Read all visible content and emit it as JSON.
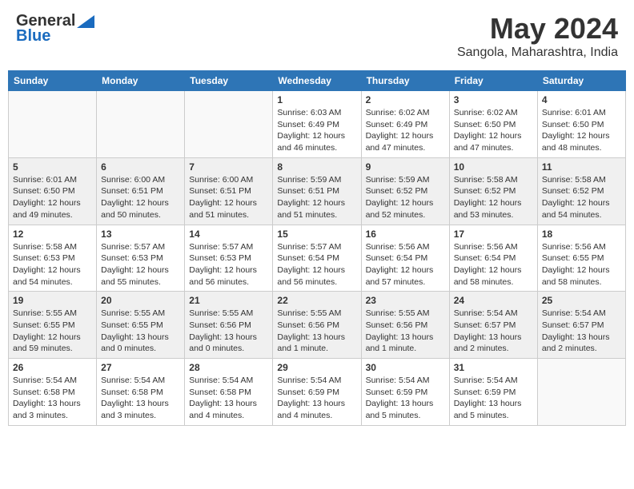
{
  "header": {
    "logo_general": "General",
    "logo_blue": "Blue",
    "month_title": "May 2024",
    "location": "Sangola, Maharashtra, India"
  },
  "weekdays": [
    "Sunday",
    "Monday",
    "Tuesday",
    "Wednesday",
    "Thursday",
    "Friday",
    "Saturday"
  ],
  "weeks": [
    [
      {
        "day": "",
        "text": ""
      },
      {
        "day": "",
        "text": ""
      },
      {
        "day": "",
        "text": ""
      },
      {
        "day": "1",
        "text": "Sunrise: 6:03 AM\nSunset: 6:49 PM\nDaylight: 12 hours\nand 46 minutes."
      },
      {
        "day": "2",
        "text": "Sunrise: 6:02 AM\nSunset: 6:49 PM\nDaylight: 12 hours\nand 47 minutes."
      },
      {
        "day": "3",
        "text": "Sunrise: 6:02 AM\nSunset: 6:50 PM\nDaylight: 12 hours\nand 47 minutes."
      },
      {
        "day": "4",
        "text": "Sunrise: 6:01 AM\nSunset: 6:50 PM\nDaylight: 12 hours\nand 48 minutes."
      }
    ],
    [
      {
        "day": "5",
        "text": "Sunrise: 6:01 AM\nSunset: 6:50 PM\nDaylight: 12 hours\nand 49 minutes."
      },
      {
        "day": "6",
        "text": "Sunrise: 6:00 AM\nSunset: 6:51 PM\nDaylight: 12 hours\nand 50 minutes."
      },
      {
        "day": "7",
        "text": "Sunrise: 6:00 AM\nSunset: 6:51 PM\nDaylight: 12 hours\nand 51 minutes."
      },
      {
        "day": "8",
        "text": "Sunrise: 5:59 AM\nSunset: 6:51 PM\nDaylight: 12 hours\nand 51 minutes."
      },
      {
        "day": "9",
        "text": "Sunrise: 5:59 AM\nSunset: 6:52 PM\nDaylight: 12 hours\nand 52 minutes."
      },
      {
        "day": "10",
        "text": "Sunrise: 5:58 AM\nSunset: 6:52 PM\nDaylight: 12 hours\nand 53 minutes."
      },
      {
        "day": "11",
        "text": "Sunrise: 5:58 AM\nSunset: 6:52 PM\nDaylight: 12 hours\nand 54 minutes."
      }
    ],
    [
      {
        "day": "12",
        "text": "Sunrise: 5:58 AM\nSunset: 6:53 PM\nDaylight: 12 hours\nand 54 minutes."
      },
      {
        "day": "13",
        "text": "Sunrise: 5:57 AM\nSunset: 6:53 PM\nDaylight: 12 hours\nand 55 minutes."
      },
      {
        "day": "14",
        "text": "Sunrise: 5:57 AM\nSunset: 6:53 PM\nDaylight: 12 hours\nand 56 minutes."
      },
      {
        "day": "15",
        "text": "Sunrise: 5:57 AM\nSunset: 6:54 PM\nDaylight: 12 hours\nand 56 minutes."
      },
      {
        "day": "16",
        "text": "Sunrise: 5:56 AM\nSunset: 6:54 PM\nDaylight: 12 hours\nand 57 minutes."
      },
      {
        "day": "17",
        "text": "Sunrise: 5:56 AM\nSunset: 6:54 PM\nDaylight: 12 hours\nand 58 minutes."
      },
      {
        "day": "18",
        "text": "Sunrise: 5:56 AM\nSunset: 6:55 PM\nDaylight: 12 hours\nand 58 minutes."
      }
    ],
    [
      {
        "day": "19",
        "text": "Sunrise: 5:55 AM\nSunset: 6:55 PM\nDaylight: 12 hours\nand 59 minutes."
      },
      {
        "day": "20",
        "text": "Sunrise: 5:55 AM\nSunset: 6:55 PM\nDaylight: 13 hours\nand 0 minutes."
      },
      {
        "day": "21",
        "text": "Sunrise: 5:55 AM\nSunset: 6:56 PM\nDaylight: 13 hours\nand 0 minutes."
      },
      {
        "day": "22",
        "text": "Sunrise: 5:55 AM\nSunset: 6:56 PM\nDaylight: 13 hours\nand 1 minute."
      },
      {
        "day": "23",
        "text": "Sunrise: 5:55 AM\nSunset: 6:56 PM\nDaylight: 13 hours\nand 1 minute."
      },
      {
        "day": "24",
        "text": "Sunrise: 5:54 AM\nSunset: 6:57 PM\nDaylight: 13 hours\nand 2 minutes."
      },
      {
        "day": "25",
        "text": "Sunrise: 5:54 AM\nSunset: 6:57 PM\nDaylight: 13 hours\nand 2 minutes."
      }
    ],
    [
      {
        "day": "26",
        "text": "Sunrise: 5:54 AM\nSunset: 6:58 PM\nDaylight: 13 hours\nand 3 minutes."
      },
      {
        "day": "27",
        "text": "Sunrise: 5:54 AM\nSunset: 6:58 PM\nDaylight: 13 hours\nand 3 minutes."
      },
      {
        "day": "28",
        "text": "Sunrise: 5:54 AM\nSunset: 6:58 PM\nDaylight: 13 hours\nand 4 minutes."
      },
      {
        "day": "29",
        "text": "Sunrise: 5:54 AM\nSunset: 6:59 PM\nDaylight: 13 hours\nand 4 minutes."
      },
      {
        "day": "30",
        "text": "Sunrise: 5:54 AM\nSunset: 6:59 PM\nDaylight: 13 hours\nand 5 minutes."
      },
      {
        "day": "31",
        "text": "Sunrise: 5:54 AM\nSunset: 6:59 PM\nDaylight: 13 hours\nand 5 minutes."
      },
      {
        "day": "",
        "text": ""
      }
    ]
  ]
}
